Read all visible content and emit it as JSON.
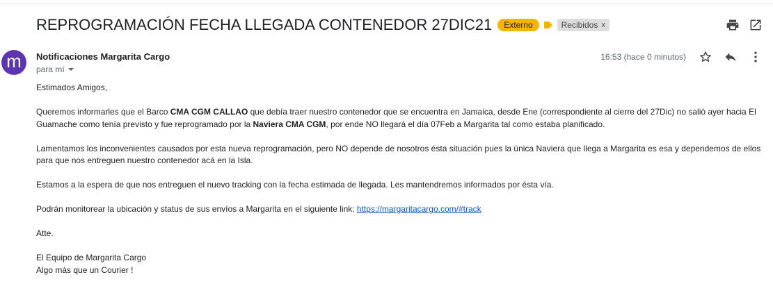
{
  "email": {
    "subject": "REPROGRAMACIÓN FECHA LLEGADA CONTENEDOR 27DIC21",
    "badge_externo": "Externo",
    "label_recibidos": "Recibidos",
    "label_close": "x",
    "avatar_initial": "m",
    "sender_name": "Notificaciones Margarita Cargo",
    "recipient": "para mí",
    "timestamp": "16:53 (hace 0 minutos)"
  },
  "icons": {
    "print": "print-icon",
    "open_new_window": "open-in-new-window-icon",
    "star": "star-icon",
    "reply": "reply-icon",
    "more": "more-vertical-icon",
    "label_arrow": "label-arrow-icon",
    "caret": "chevron-down-icon"
  },
  "colors": {
    "badge_externo": "#f5b400",
    "avatar_bg": "#5e35b1",
    "link": "#1155cc"
  },
  "body": {
    "greeting": "Estimados Amigos,",
    "p1_a": "Queremos informarles que el Barco ",
    "p1_b": "CMA CGM CALLAO",
    "p1_c": " que debía traer nuestro contenedor que se encuentra en Jamaica, desde Ene (correspondiente al cierre del 27Dic) no salió ayer hacia El Guamache como tenía previsto y fue reprogramado por la ",
    "p1_d": "Naviera CMA CGM",
    "p1_e": ", por ende NO llegará el día 07Feb a Margarita tal como estaba planificado.",
    "p2": "Lamentamos los inconvenientes causados por esta nueva reprogramación, pero NO depende de nosotros ésta situación pues la única Naviera que llega a Margarita es esa y dependemos de ellos para que nos entreguen nuestro contenedor acá en la Isla.",
    "p3": "Estamos a la espera de que nos entreguen el nuevo tracking con la fecha estimada de llegada. Les mantendremos informados por ésta vía.",
    "p4_text": "Podrán monitorear la ubicación y status de sus envíos a Margarita en el siguiente link: ",
    "p4_link": "https://margaritacargo.com/#track",
    "closing": "Atte.",
    "signature_1": "El Equipo de Margarita Cargo",
    "signature_2": "Algo más que un Courier !"
  }
}
